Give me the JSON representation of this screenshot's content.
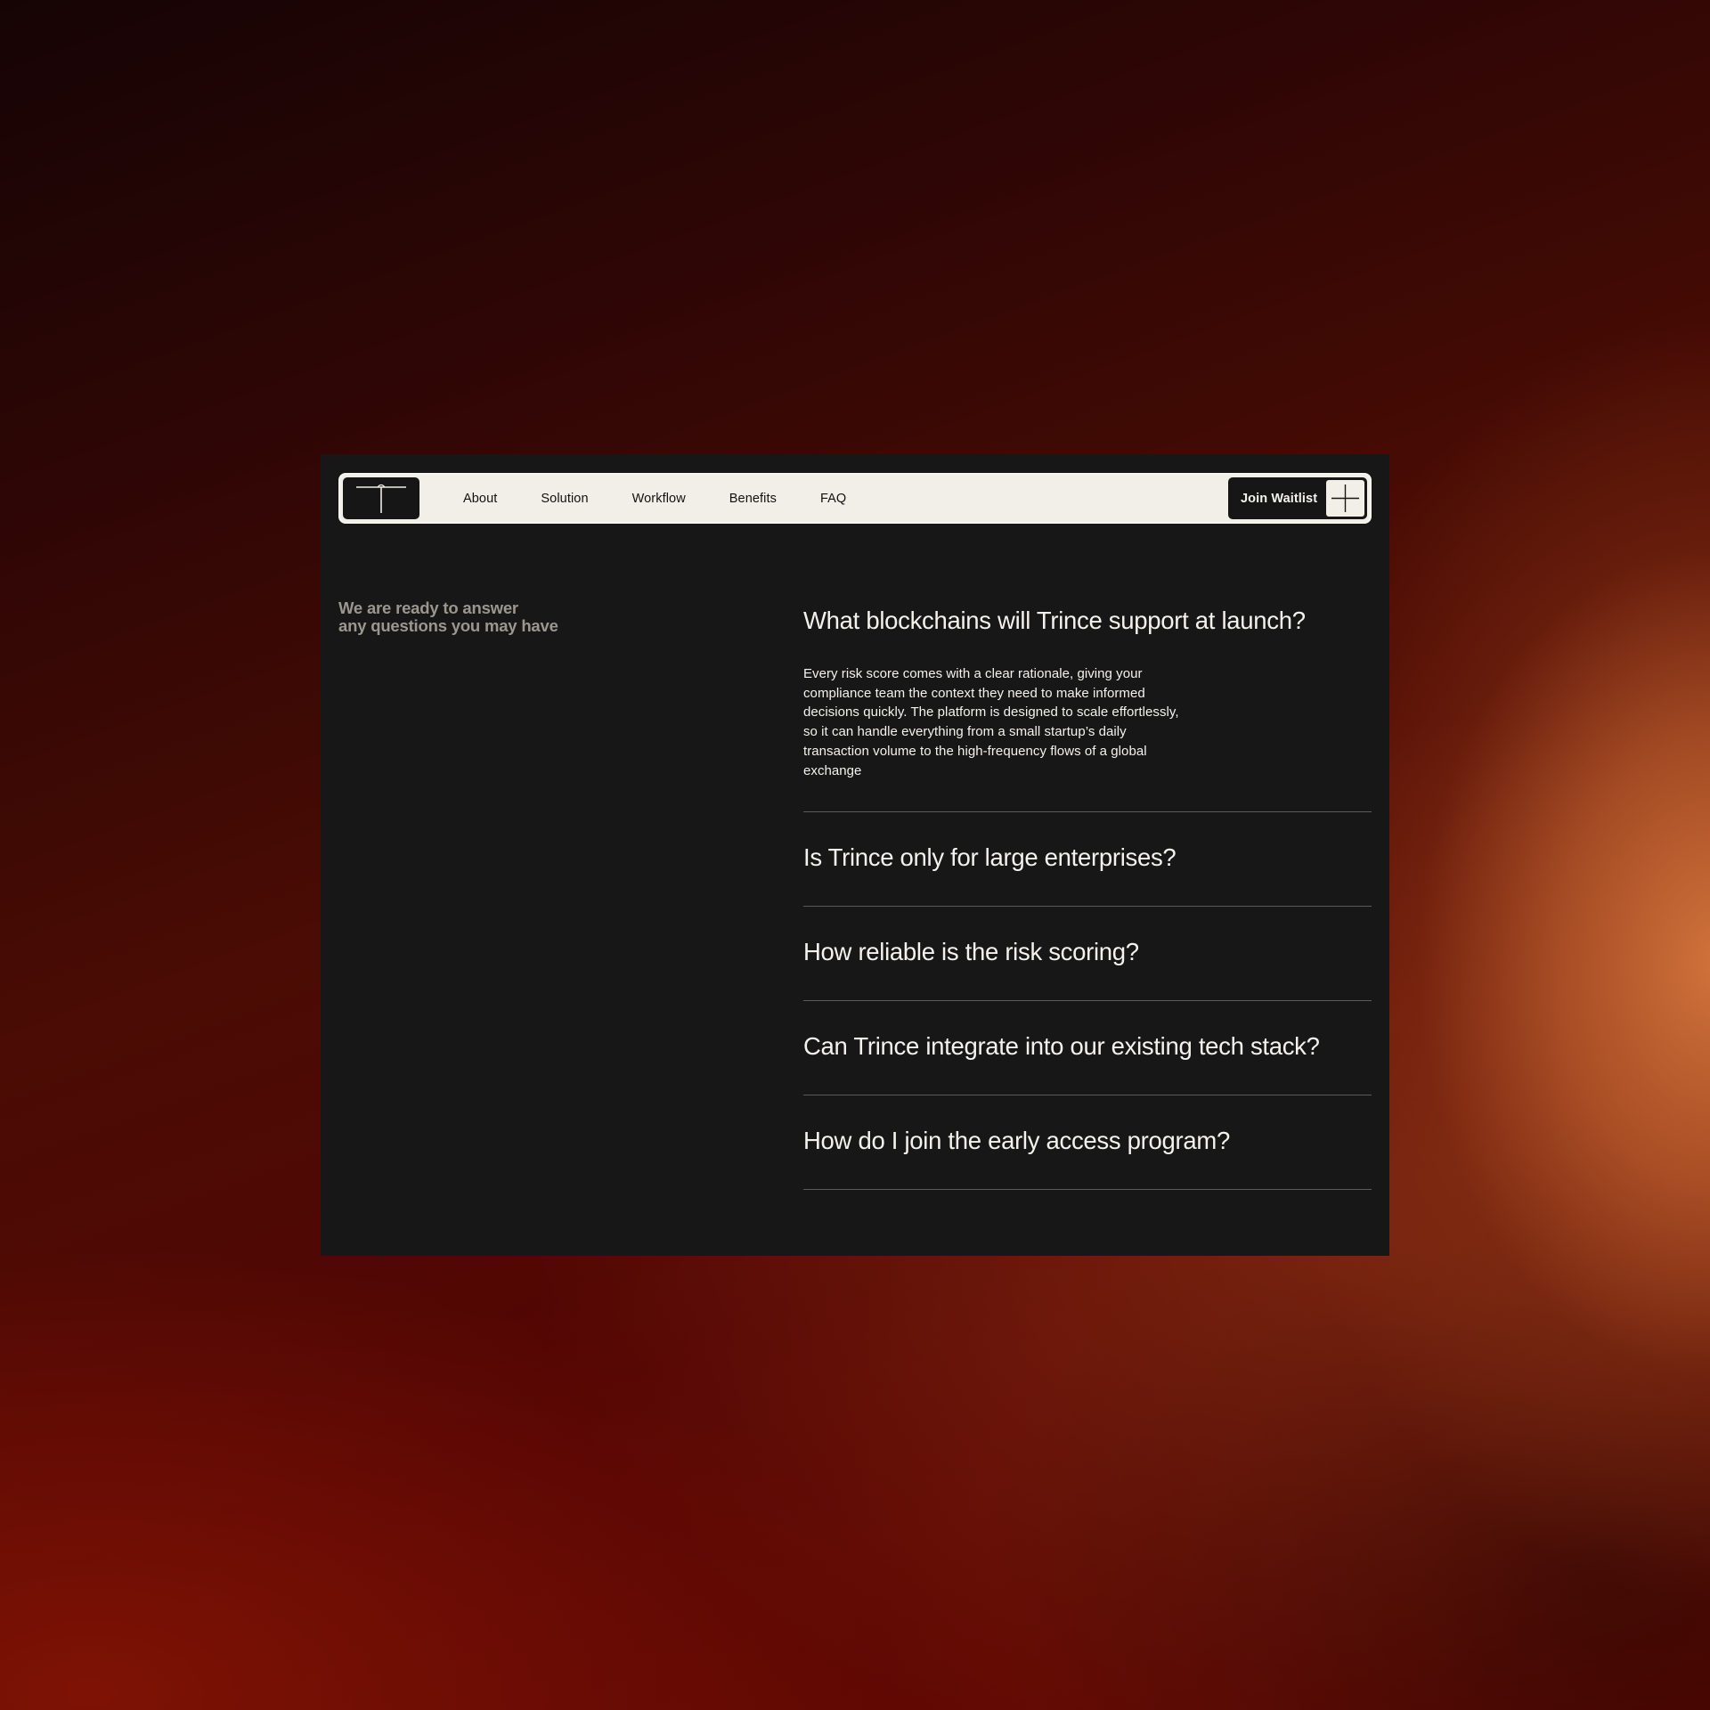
{
  "nav": {
    "logo_icon": "t-bar-logo-icon",
    "links": [
      "About",
      "Solution",
      "Workflow",
      "Benefits",
      "FAQ"
    ],
    "cta_label": "Join Waitlist",
    "cta_icon": "crosshair-plus-icon"
  },
  "intro": {
    "line1": "We are ready to answer",
    "line2": "any questions you may have"
  },
  "faq": [
    {
      "question": "What blockchains will Trince support at launch?",
      "answer": "Every risk score comes with a clear rationale, giving your compliance team the context they need to make informed decisions quickly. The platform is designed to scale effortlessly, so it can handle everything from a small startup’s daily transaction volume to the high-frequency flows of a global exchange",
      "expanded": true
    },
    {
      "question": "Is Trince only for large enterprises?",
      "expanded": false
    },
    {
      "question": "How reliable is the risk scoring?",
      "expanded": false
    },
    {
      "question": "Can Trince integrate into our existing tech stack?",
      "expanded": false
    },
    {
      "question": "How do I join the early access program?",
      "expanded": false
    }
  ],
  "colors": {
    "panel_bg": "#171717",
    "nav_bg": "#f2efe8",
    "text_light": "#f4f2ec",
    "text_muted": "#9c978e",
    "divider": "#5a5a5a"
  }
}
